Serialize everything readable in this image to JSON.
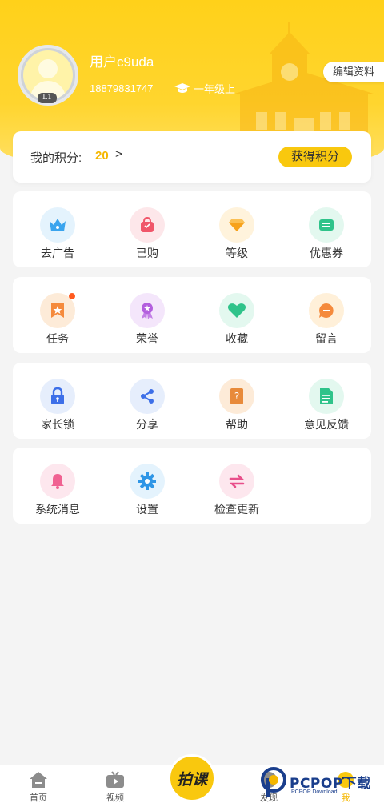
{
  "profile": {
    "username": "用户c9uda",
    "phone": "18879831747",
    "grade": "一年级上",
    "level_badge": "L1",
    "edit_label": "编辑资料"
  },
  "points": {
    "label": "我的积分:",
    "value": "20",
    "arrow": ">",
    "earn_label": "获得积分"
  },
  "menu_rows": [
    [
      {
        "label": "去广告",
        "icon": "crown-icon"
      },
      {
        "label": "已购",
        "icon": "shopping-bag-icon"
      },
      {
        "label": "等级",
        "icon": "diamond-icon"
      },
      {
        "label": "优惠券",
        "icon": "coupon-icon"
      }
    ],
    [
      {
        "label": "任务",
        "icon": "task-star-icon"
      },
      {
        "label": "荣誉",
        "icon": "medal-icon"
      },
      {
        "label": "收藏",
        "icon": "heart-icon"
      },
      {
        "label": "留言",
        "icon": "message-icon"
      }
    ],
    [
      {
        "label": "家长锁",
        "icon": "lock-icon"
      },
      {
        "label": "分享",
        "icon": "share-icon"
      },
      {
        "label": "帮助",
        "icon": "help-book-icon"
      },
      {
        "label": "意见反馈",
        "icon": "feedback-doc-icon"
      }
    ],
    [
      {
        "label": "系统消息",
        "icon": "bell-icon"
      },
      {
        "label": "设置",
        "icon": "gear-icon"
      },
      {
        "label": "检查更新",
        "icon": "refresh-icon"
      }
    ]
  ],
  "tabbar": {
    "home": "首页",
    "video": "视频",
    "center": "拍课",
    "discover": "发现",
    "me": "我"
  },
  "watermark": {
    "text": "PCPOP下载",
    "sub": "PCPOP Download"
  },
  "colors": {
    "brand_yellow": "#f9c80e",
    "points_value": "#f5b700",
    "badge_dot": "#ff5a1f"
  }
}
